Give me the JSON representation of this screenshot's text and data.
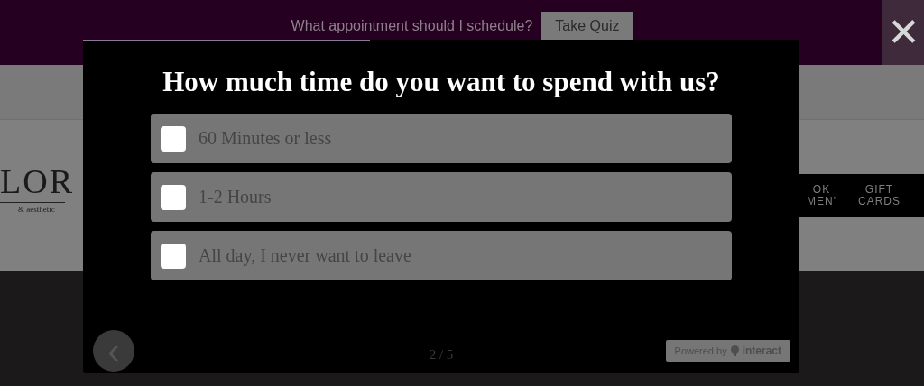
{
  "banner": {
    "text": "What appointment should I schedule?",
    "button": "Take Quiz"
  },
  "close": {
    "label": "✕"
  },
  "site": {
    "logo": "LOR",
    "tagline": "& aesthetic",
    "nav": [
      {
        "lines": [
          "OK",
          "MEN'"
        ]
      },
      {
        "lines": [
          "GIFT",
          "CARDS"
        ]
      }
    ]
  },
  "quiz": {
    "progress": {
      "level": 0.4
    },
    "question": "How much time do you want to spend with us?",
    "options": [
      {
        "label": "60 Minutes or less",
        "checked": false
      },
      {
        "label": "1-2 Hours",
        "checked": false
      },
      {
        "label": "All day, I never want to leave",
        "checked": false
      }
    ],
    "back": "‹",
    "page": "2 / 5",
    "powered": {
      "text": "Powered by",
      "brand": "interact"
    }
  }
}
